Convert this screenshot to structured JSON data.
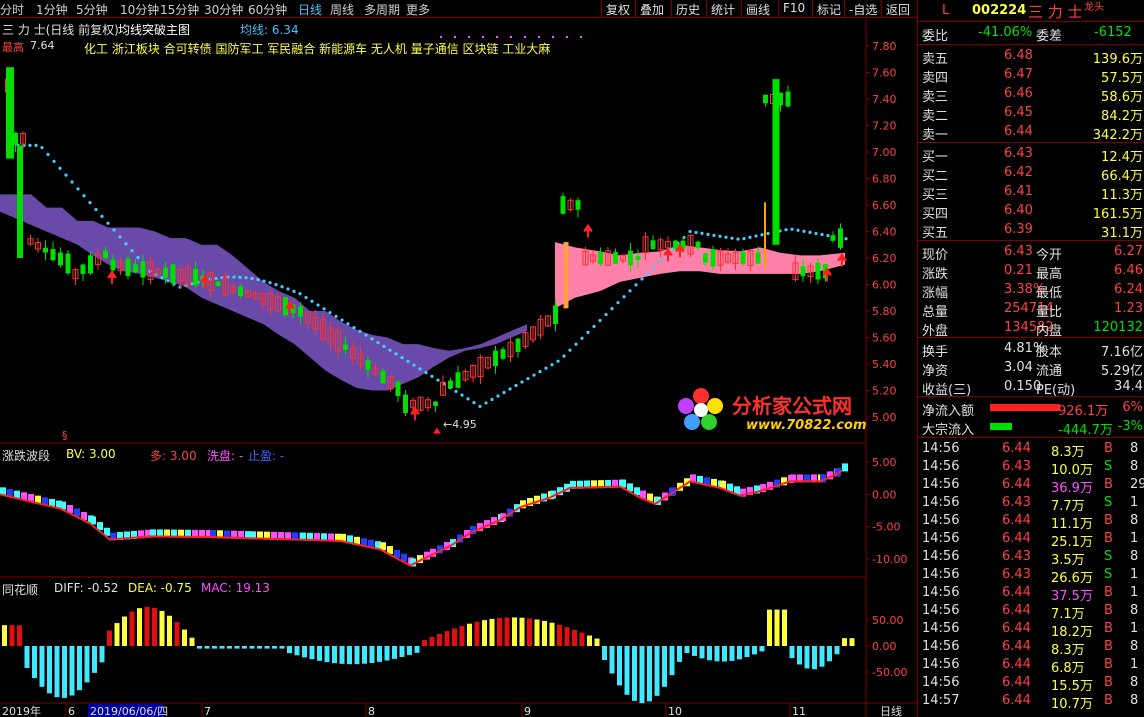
{
  "toolbar": {
    "periods": [
      "分时",
      "1分钟",
      "5分钟",
      "10分钟",
      "15分钟",
      "30分钟",
      "60分钟",
      "日线",
      "周线",
      "多周期",
      "更多"
    ],
    "right_buttons": [
      "复权",
      "叠加",
      "历史",
      "统计",
      "画线",
      "F10",
      "标记",
      "-自选",
      "返回"
    ]
  },
  "main": {
    "title": "三 力 士(日线 前复权)",
    "indicator": "均线突破主图",
    "ma_label": "均线: 6.34",
    "high_label": "7.64",
    "high_prefix": "最高",
    "low_label": "4.95",
    "concepts": "化工 浙江板块 合可转债 国防军工 军民融合 新能源车 无人机 量子通信 区块链 工业大麻",
    "yaxis": [
      "7.80",
      "7.60",
      "7.40",
      "7.20",
      "7.00",
      "6.80",
      "6.60",
      "6.40",
      "6.20",
      "6.00",
      "5.80",
      "5.60",
      "5.40",
      "5.20",
      "5.00"
    ],
    "watermark_text": "分析家公式网",
    "watermark_url": "www.70822.com"
  },
  "sub1": {
    "name": "涨跌波段",
    "bv": "BV: 3.00",
    "duo": "多: 3.00",
    "xipan": "洗盘: -",
    "zhiying": "止盈: -",
    "yaxis": [
      "5.00",
      "0.00",
      "-5.00",
      "-10.00"
    ]
  },
  "sub2": {
    "name": "同花顺",
    "diff": "DIFF: -0.52",
    "dea": "DEA: -0.75",
    "mac": "MAC: 19.13",
    "yaxis": [
      "50.00",
      "0.00",
      "-50.00"
    ]
  },
  "xaxis": {
    "labels": [
      "2019年",
      "6",
      "2019/06/06/四",
      "7",
      "8",
      "9",
      "10",
      "11"
    ],
    "period": "日线"
  },
  "quote": {
    "code": "002224",
    "name": "三 力 士",
    "tag": "龙头",
    "l": "L",
    "weibi_label": "委比",
    "weibi": "-41.06%",
    "weicha_label": "委差",
    "weicha": "-6152",
    "sell": [
      {
        "label": "卖五",
        "price": "6.48",
        "vol": "139.6万"
      },
      {
        "label": "卖四",
        "price": "6.47",
        "vol": "57.5万"
      },
      {
        "label": "卖三",
        "price": "6.46",
        "vol": "58.6万"
      },
      {
        "label": "卖二",
        "price": "6.45",
        "vol": "84.2万"
      },
      {
        "label": "卖一",
        "price": "6.44",
        "vol": "342.2万"
      }
    ],
    "buy": [
      {
        "label": "买一",
        "price": "6.43",
        "vol": "12.4万"
      },
      {
        "label": "买二",
        "price": "6.42",
        "vol": "66.4万"
      },
      {
        "label": "买三",
        "price": "6.41",
        "vol": "11.3万"
      },
      {
        "label": "买四",
        "price": "6.40",
        "vol": "161.5万"
      },
      {
        "label": "买五",
        "price": "6.39",
        "vol": "31.1万"
      }
    ],
    "stats": [
      {
        "l1": "现价",
        "v1": "6.43",
        "l2": "今开",
        "v2": "6.27"
      },
      {
        "l1": "涨跌",
        "v1": "0.21",
        "l2": "最高",
        "v2": "6.46"
      },
      {
        "l1": "涨幅",
        "v1": "3.38%",
        "l2": "最低",
        "v2": "6.24"
      },
      {
        "l1": "总量",
        "v1": "254714",
        "l2": "量比",
        "v2": "1.23"
      },
      {
        "l1": "外盘",
        "v1": "134582",
        "l2": "内盘",
        "v2": "120132"
      }
    ],
    "stats2": [
      {
        "l1": "换手",
        "v1": "4.81%",
        "l2": "股本",
        "v2": "7.16亿"
      },
      {
        "l1": "净资",
        "v1": "3.04",
        "l2": "流通",
        "v2": "5.29亿"
      },
      {
        "l1": "收益(三)",
        "v1": "0.150",
        "l2": "PE(动)",
        "v2": "34.4"
      }
    ],
    "flow": [
      {
        "label": "净流入额",
        "val": "926.1万",
        "pct": "6%"
      },
      {
        "label": "大宗流入",
        "val": "-444.7万",
        "pct": "-3%"
      }
    ],
    "ticks": [
      {
        "t": "14:56",
        "p": "6.44",
        "v": "8.3万",
        "d": "B",
        "n": "8"
      },
      {
        "t": "14:56",
        "p": "6.43",
        "v": "10.0万",
        "d": "S",
        "n": "8"
      },
      {
        "t": "14:56",
        "p": "6.44",
        "v": "36.9万",
        "d": "B",
        "n": "29"
      },
      {
        "t": "14:56",
        "p": "6.43",
        "v": "7.7万",
        "d": "S",
        "n": "1"
      },
      {
        "t": "14:56",
        "p": "6.44",
        "v": "11.1万",
        "d": "B",
        "n": "8"
      },
      {
        "t": "14:56",
        "p": "6.44",
        "v": "25.1万",
        "d": "B",
        "n": "1"
      },
      {
        "t": "14:56",
        "p": "6.43",
        "v": "3.5万",
        "d": "S",
        "n": "8"
      },
      {
        "t": "14:56",
        "p": "6.43",
        "v": "26.6万",
        "d": "S",
        "n": "1"
      },
      {
        "t": "14:56",
        "p": "6.44",
        "v": "37.5万",
        "d": "B",
        "n": "1"
      },
      {
        "t": "14:56",
        "p": "6.44",
        "v": "7.1万",
        "d": "B",
        "n": "8"
      },
      {
        "t": "14:56",
        "p": "6.44",
        "v": "18.2万",
        "d": "B",
        "n": "1"
      },
      {
        "t": "14:56",
        "p": "6.44",
        "v": "8.3万",
        "d": "B",
        "n": "8"
      },
      {
        "t": "14:56",
        "p": "6.44",
        "v": "6.8万",
        "d": "B",
        "n": "1"
      },
      {
        "t": "14:56",
        "p": "6.44",
        "v": "15.5万",
        "d": "B",
        "n": "8"
      },
      {
        "t": "14:57",
        "p": "6.44",
        "v": "10.7万",
        "d": "B",
        "n": "8"
      }
    ]
  },
  "colors": {
    "up": "#ff3030",
    "down": "#00e000",
    "border": "#800000",
    "cloud_purple": "#6a4aa8",
    "cloud_pink": "#ff80a8",
    "dots": "#40d0ff",
    "accent_yellow": "#ffff00",
    "macd_red": "#e01010",
    "macd_yellow": "#ffff40",
    "macd_cyan": "#40e8ff"
  }
}
